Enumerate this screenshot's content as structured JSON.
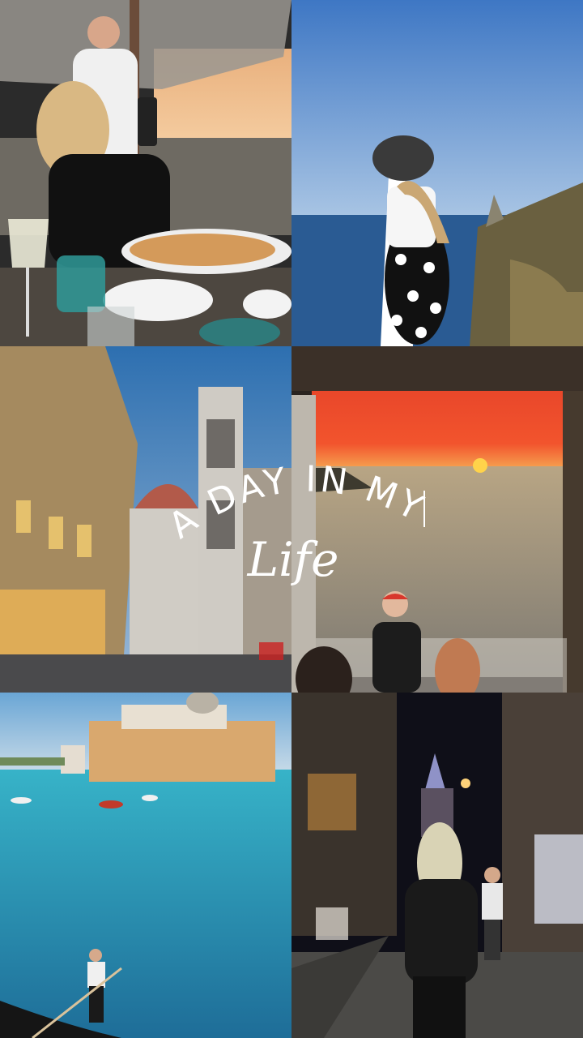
{
  "title": {
    "line1": "A DAY IN MY",
    "line2": "Life"
  },
  "tiles": [
    {
      "name": "restaurant-terrace-photo"
    },
    {
      "name": "coastal-cliff-photo"
    },
    {
      "name": "florence-cathedral-photo"
    },
    {
      "name": "sunset-terrace-photo"
    },
    {
      "name": "venice-canal-photo"
    },
    {
      "name": "istanbul-night-street-photo"
    }
  ],
  "colors": {
    "text": "#ffffff",
    "sunset": "#f2542d",
    "sea": "#2a5b93",
    "canal": "#2fa6bf"
  }
}
